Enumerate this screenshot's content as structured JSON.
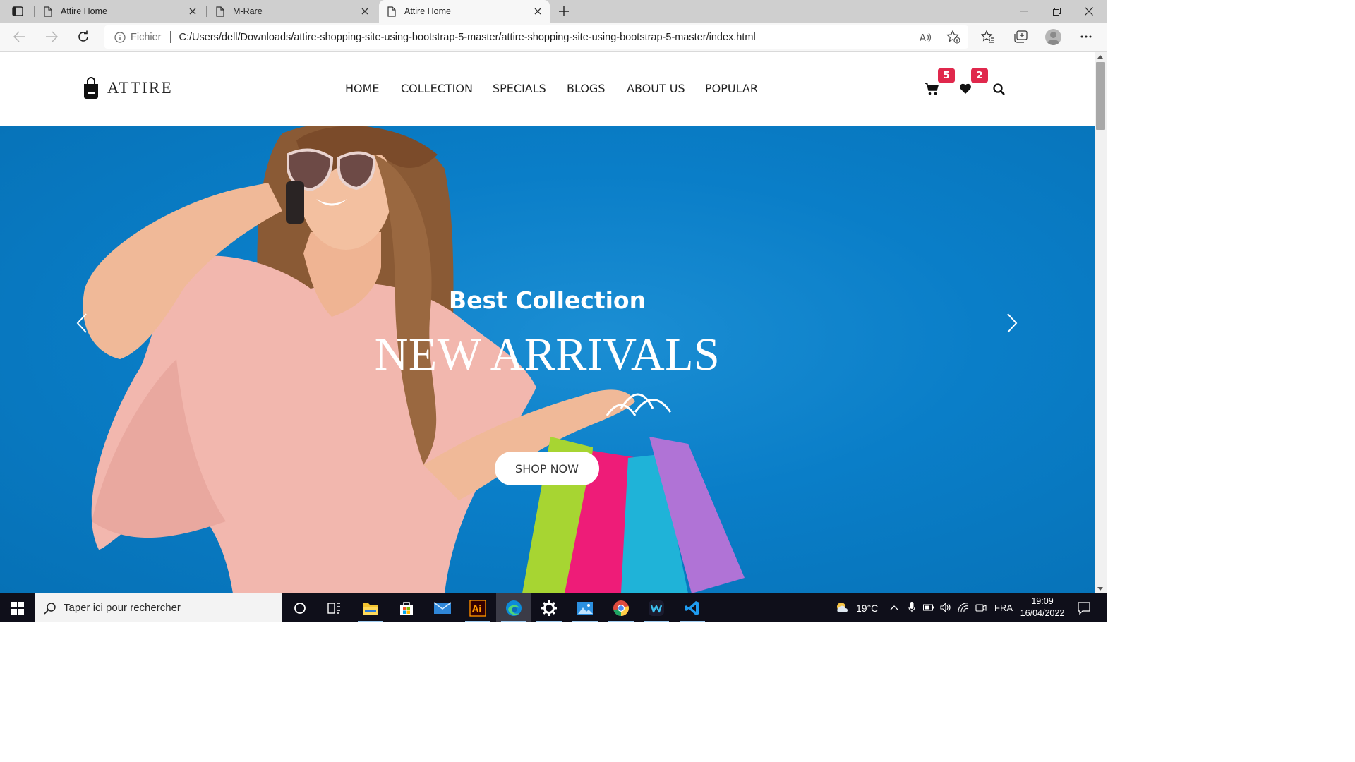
{
  "browser": {
    "tabs": [
      {
        "title": "Attire Home",
        "active": false
      },
      {
        "title": "M-Rare",
        "active": false
      },
      {
        "title": "Attire Home",
        "active": true
      }
    ],
    "address": {
      "scheme_label": "Fichier",
      "url": "C:/Users/dell/Downloads/attire-shopping-site-using-bootstrap-5-master/attire-shopping-site-using-bootstrap-5-master/index.html"
    }
  },
  "site": {
    "brand": "ATTIRE",
    "nav": [
      "HOME",
      "COLLECTION",
      "SPECIALS",
      "BLOGS",
      "ABOUT US",
      "POPULAR"
    ],
    "cart_count": "5",
    "wishlist_count": "2",
    "hero": {
      "subtitle": "Best Collection",
      "title": "NEW ARRIVALS",
      "cta": "SHOP NOW"
    },
    "colors": {
      "hero_bg": "#0a7ec8",
      "badge": "#e0284c"
    }
  },
  "taskbar": {
    "search_placeholder": "Taper ici pour rechercher",
    "apps": [
      "task-view-icon",
      "file-explorer-icon",
      "microsoft-store-icon",
      "mail-icon",
      "illustrator-icon",
      "edge-icon",
      "settings-icon",
      "photos-icon",
      "chrome-icon",
      "webex-icon",
      "vscode-icon"
    ],
    "weather": "19°C",
    "language": "FRA",
    "time": "19:09",
    "date": "16/04/2022"
  }
}
